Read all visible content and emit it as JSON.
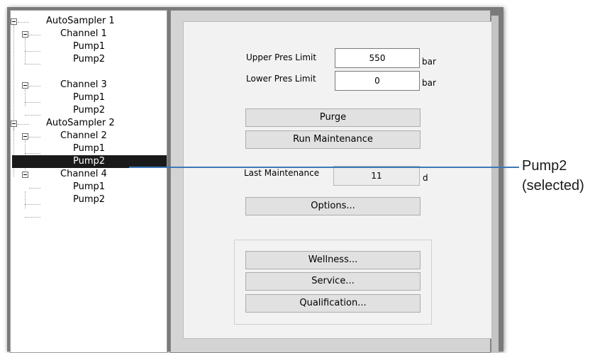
{
  "tree": {
    "nodes": [
      {
        "label": "AutoSampler 1",
        "expander": "minus-icon"
      },
      {
        "label": "Channel 1",
        "expander": "minus-icon"
      },
      {
        "label": "Pump1"
      },
      {
        "label": "Pump2"
      },
      {
        "label": "Channel 3",
        "expander": "minus-icon"
      },
      {
        "label": "Pump1"
      },
      {
        "label": "Pump2"
      },
      {
        "label": "AutoSampler 2",
        "expander": "minus-icon"
      },
      {
        "label": "Channel 2",
        "expander": "minus-icon"
      },
      {
        "label": "Pump1"
      },
      {
        "label": "Pump2",
        "selected": true
      },
      {
        "label": "Channel 4",
        "expander": "minus-icon"
      },
      {
        "label": "Pump1"
      },
      {
        "label": "Pump2"
      }
    ]
  },
  "pressure": {
    "upper_label": "Upper Pres Limit",
    "upper_value": "550",
    "upper_unit": "bar",
    "lower_label": "Lower Pres Limit",
    "lower_value": "0",
    "lower_unit": "bar"
  },
  "buttons": {
    "purge": "Purge",
    "run_maintenance": "Run Maintenance",
    "options": "Options...",
    "wellness": "Wellness...",
    "service": "Service...",
    "qualification": "Qualification..."
  },
  "maintenance": {
    "label": "Last Maintenance",
    "value": "11",
    "unit": "d"
  },
  "callout": {
    "line1": "Pump2",
    "line2": "(selected)"
  },
  "colors": {
    "selection_bg": "#1a1a1a",
    "callout_line": "#3b79b7"
  }
}
